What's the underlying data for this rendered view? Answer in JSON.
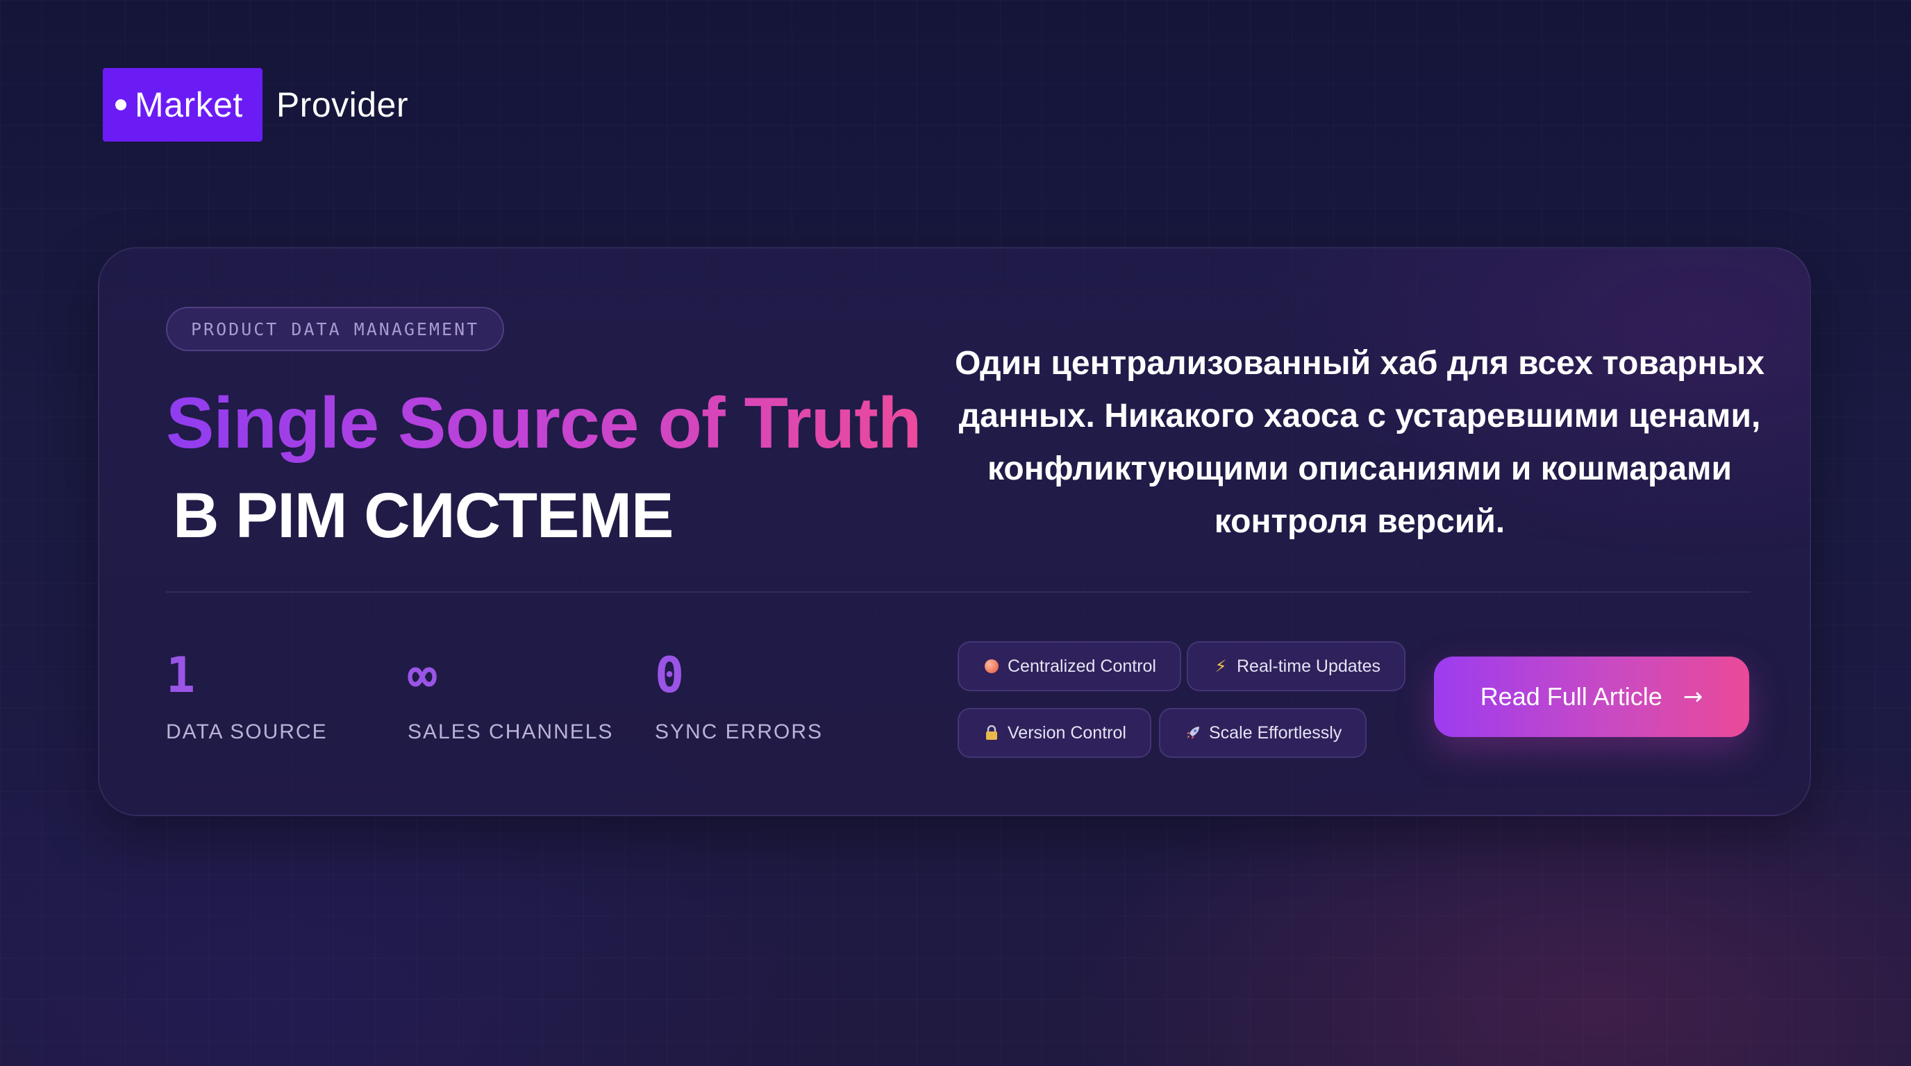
{
  "brand": {
    "badge_label": "Market",
    "name": "Provider",
    "badge_color": "#6b1cf5"
  },
  "hero": {
    "tag": "PRODUCT DATA MANAGEMENT",
    "headline": "Single Source of Truth",
    "subheadline": "В PIM СИСТЕМЕ",
    "description": "Один централизованный хаб для всех товарных данных. Никакого хаоса с устаревшими ценами, конфликтующими описаниями и кошмарами контроля версий.",
    "headline_gradient": [
      "#8f3df0",
      "#c043d8",
      "#ec4a9c"
    ]
  },
  "stats": [
    {
      "value": "1",
      "label": "DATA SOURCE"
    },
    {
      "value": "∞",
      "label": "SALES CHANNELS"
    },
    {
      "value": "0",
      "label": "SYNC ERRORS"
    }
  ],
  "features": [
    {
      "icon": "red-dot-icon",
      "label": "Centralized Control"
    },
    {
      "icon": "lightning-icon",
      "label": "Real-time Updates"
    },
    {
      "icon": "lock-icon",
      "label": "Version Control"
    },
    {
      "icon": "rocket-icon",
      "label": "Scale Effortlessly"
    }
  ],
  "cta": {
    "label": "Read Full Article",
    "arrow": "→",
    "gradient": [
      "#9c3cf0",
      "#ea4a98"
    ]
  }
}
